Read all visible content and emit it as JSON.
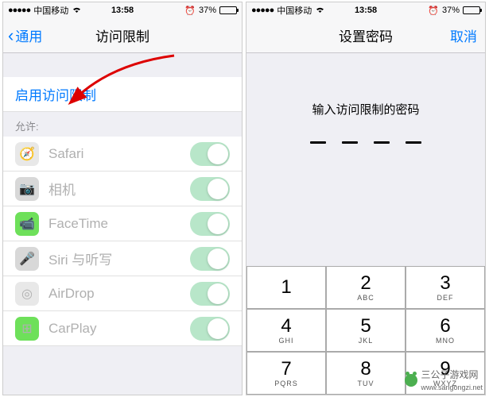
{
  "status": {
    "carrier": "中国移动",
    "time": "13:58",
    "battery": "37%"
  },
  "left": {
    "back": "通用",
    "title": "访问限制",
    "enable": "启用访问限制",
    "allow": "允许:",
    "apps": [
      {
        "name": "Safari",
        "icon_bg": "#e8e8e8",
        "glyph": "🧭"
      },
      {
        "name": "相机",
        "icon_bg": "#d8d8d8",
        "glyph": "📷"
      },
      {
        "name": "FaceTime",
        "icon_bg": "#6ee05a",
        "glyph": "📹"
      },
      {
        "name": "Siri 与听写",
        "icon_bg": "#d8d8d8",
        "glyph": "🎤"
      },
      {
        "name": "AirDrop",
        "icon_bg": "#e8e8e8",
        "glyph": "◎"
      },
      {
        "name": "CarPlay",
        "icon_bg": "#6ee05a",
        "glyph": "⊞"
      }
    ]
  },
  "right": {
    "title": "设置密码",
    "cancel": "取消",
    "prompt": "输入访问限制的密码",
    "keys": [
      {
        "n": "1",
        "s": ""
      },
      {
        "n": "2",
        "s": "ABC"
      },
      {
        "n": "3",
        "s": "DEF"
      },
      {
        "n": "4",
        "s": "GHI"
      },
      {
        "n": "5",
        "s": "JKL"
      },
      {
        "n": "6",
        "s": "MNO"
      },
      {
        "n": "7",
        "s": "PQRS"
      },
      {
        "n": "8",
        "s": "TUV"
      },
      {
        "n": "9",
        "s": "WXYZ"
      }
    ]
  },
  "watermark": {
    "brand": "三公子游戏网",
    "url": "www.sangongzi.net"
  }
}
